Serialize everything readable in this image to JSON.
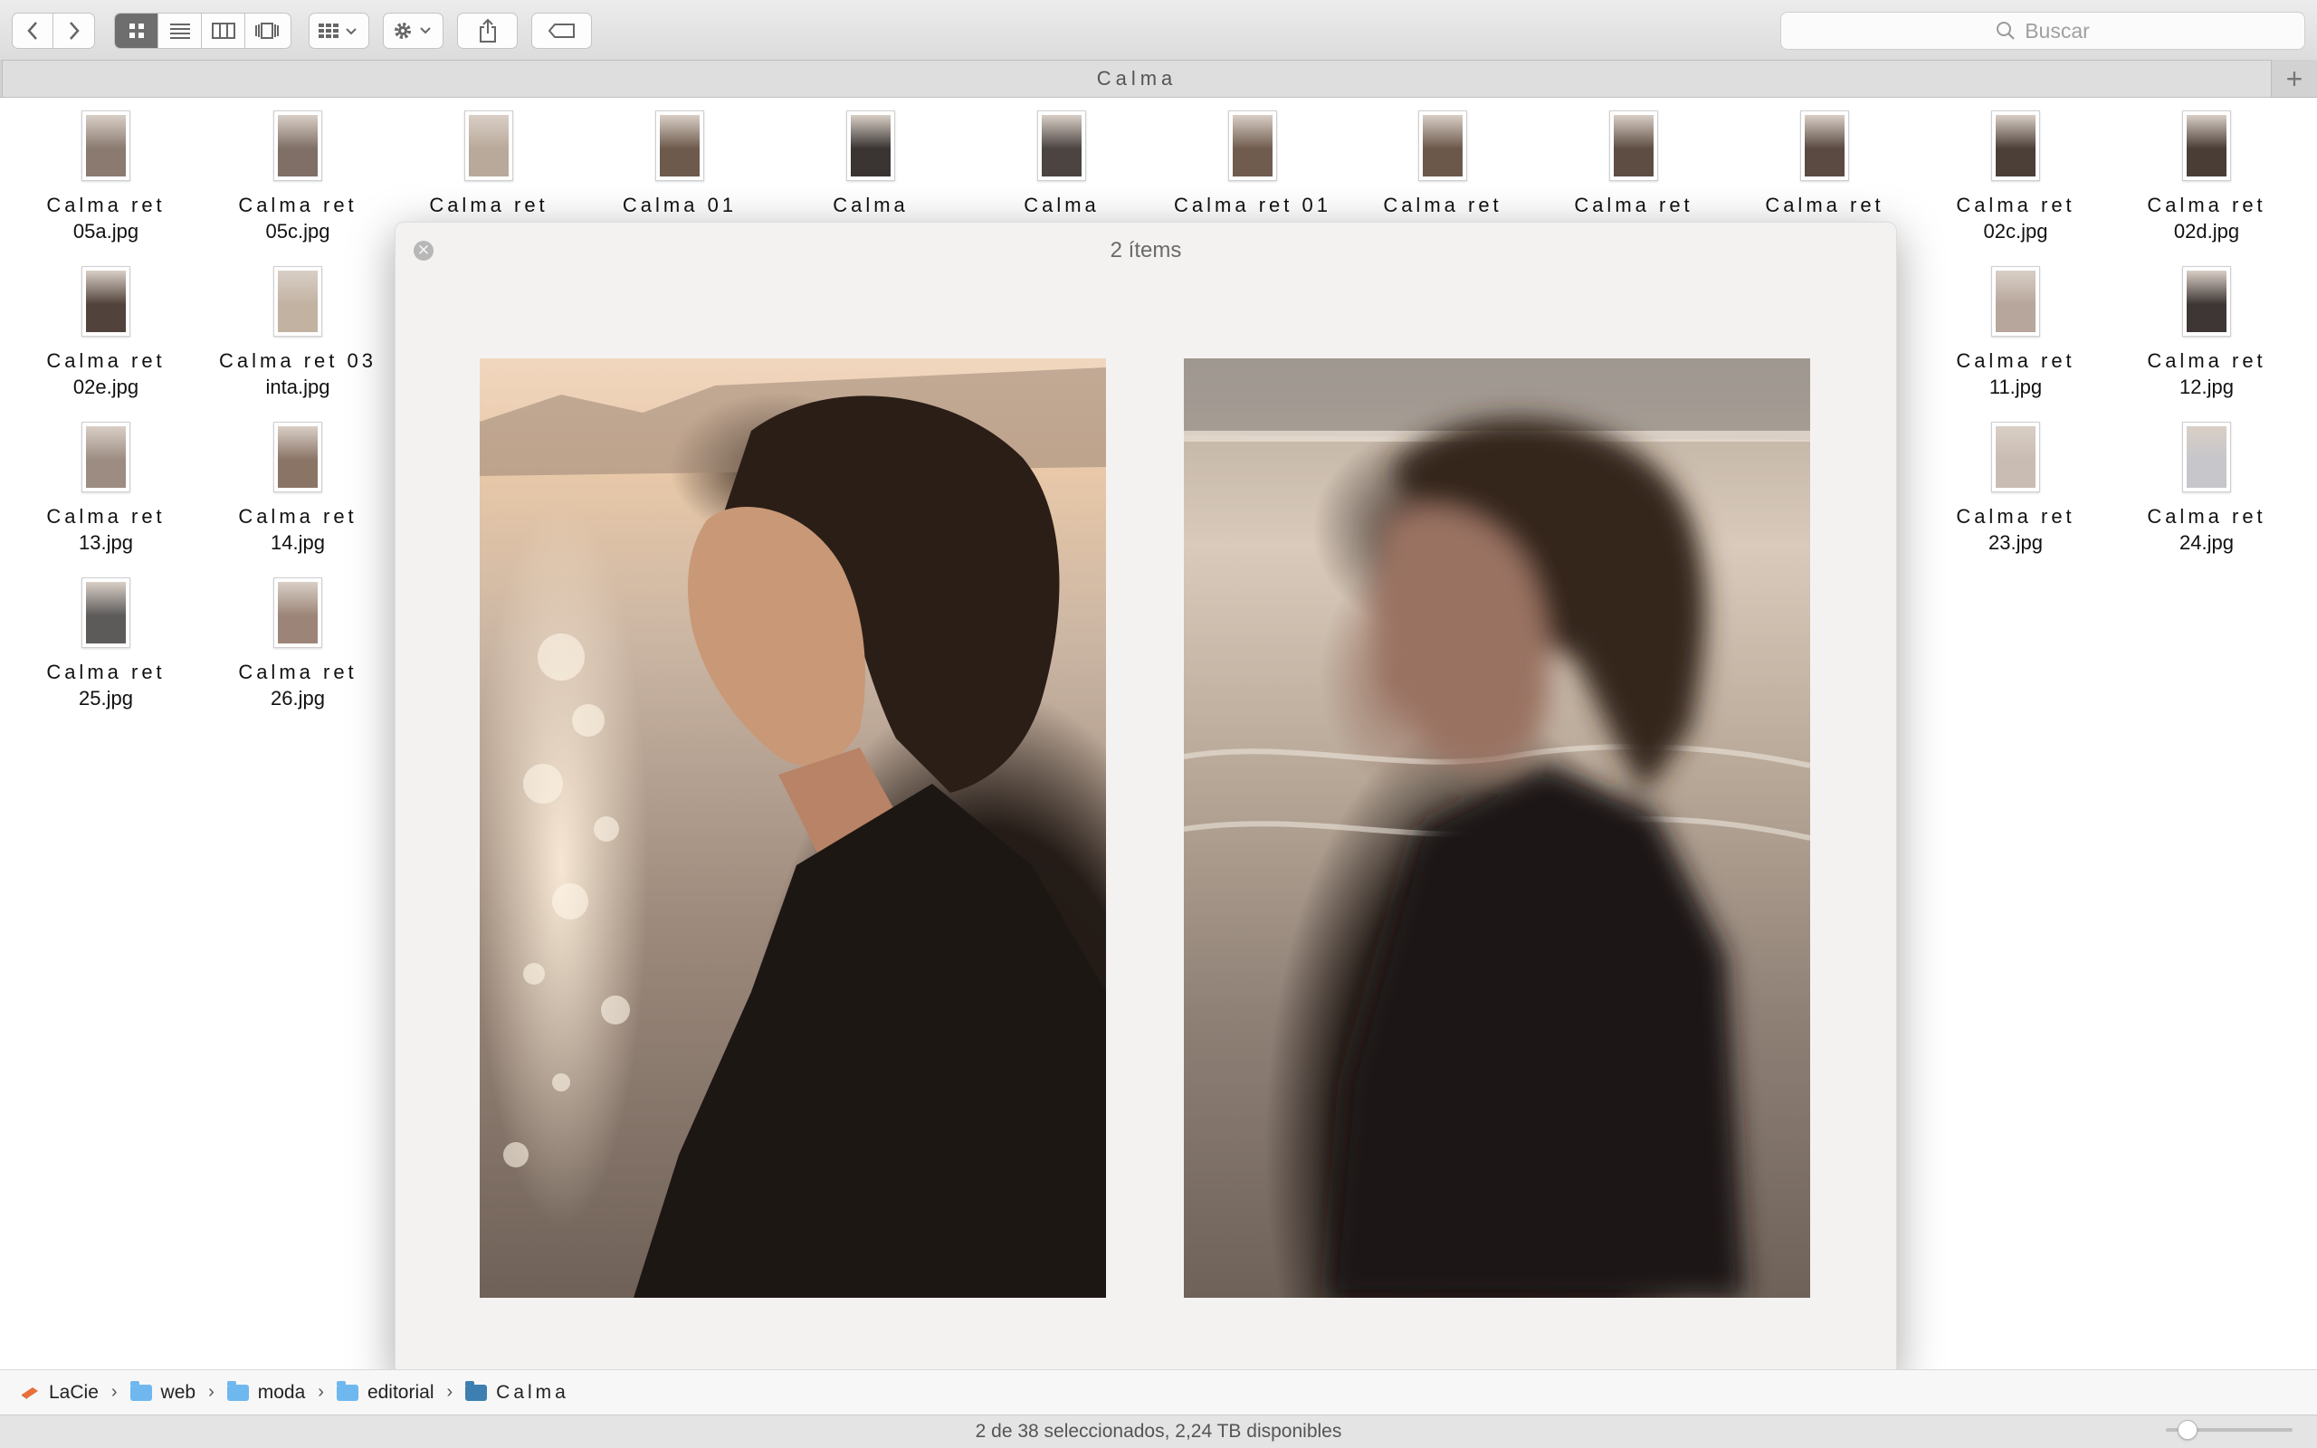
{
  "toolbar": {
    "search_placeholder": "Buscar",
    "nav": [
      "back-icon",
      "forward-icon"
    ],
    "view_modes": [
      "icon-view-icon",
      "list-view-icon",
      "column-view-icon",
      "cover-flow-icon"
    ],
    "active_view": "icon-view-icon"
  },
  "tab": {
    "title": "Calma",
    "add_label": "+"
  },
  "files": [
    {
      "line1": "Calma ret",
      "line2": "05a.jpg",
      "tint": "#8a7a70"
    },
    {
      "line1": "Calma ret",
      "line2": "05c.jpg",
      "tint": "#7f6f66"
    },
    {
      "line1": "Calma ret",
      "line2": "",
      "tint": "#b9a99a"
    },
    {
      "line1": "Calma 01",
      "line2": "",
      "tint": "#6e5a4c"
    },
    {
      "line1": "Calma",
      "line2": "",
      "tint": "#3a3533"
    },
    {
      "line1": "Calma",
      "line2": "",
      "tint": "#4b4441"
    },
    {
      "line1": "Calma ret 01",
      "line2": "",
      "tint": "#705c4e"
    },
    {
      "line1": "Calma ret",
      "line2": "",
      "tint": "#6c584b"
    },
    {
      "line1": "Calma ret",
      "line2": "",
      "tint": "#5e4d43"
    },
    {
      "line1": "Calma ret",
      "line2": "",
      "tint": "#5a4a41"
    },
    {
      "line1": "Calma ret",
      "line2": "02c.jpg",
      "tint": "#4c3f38"
    },
    {
      "line1": "Calma ret",
      "line2": "02d.jpg",
      "tint": "#4a3d36"
    },
    {
      "line1": "Calma ret",
      "line2": "02e.jpg",
      "tint": "#51433b"
    },
    {
      "line1": "Calma ret 03",
      "line2": "inta.jpg",
      "tint": "#c2b2a2"
    },
    {
      "line1": "Calma ret",
      "line2": "11.jpg",
      "tint": "#b7a69b"
    },
    {
      "line1": "Calma ret",
      "line2": "12.jpg",
      "tint": "#3d3634"
    },
    {
      "line1": "Calma ret",
      "line2": "13.jpg",
      "tint": "#9c8c82"
    },
    {
      "line1": "Calma ret",
      "line2": "14.jpg",
      "tint": "#8a7466"
    },
    {
      "line1": "Calma ret",
      "line2": "23.jpg",
      "tint": "#c9bcb2"
    },
    {
      "line1": "Calma ret",
      "line2": "24.jpg",
      "tint": "#c7c6cb"
    },
    {
      "line1": "Calma ret",
      "line2": "25.jpg",
      "tint": "#5d5a5a"
    },
    {
      "line1": "Calma ret",
      "line2": "26.jpg",
      "tint": "#9c8578"
    }
  ],
  "quicklook": {
    "title": "2 ítems"
  },
  "pathbar": {
    "drive": "LaCie",
    "items": [
      "web",
      "moda",
      "editorial",
      "Calma"
    ]
  },
  "status": {
    "text": "2 de 38 seleccionados, 2,24 TB disponibles"
  }
}
